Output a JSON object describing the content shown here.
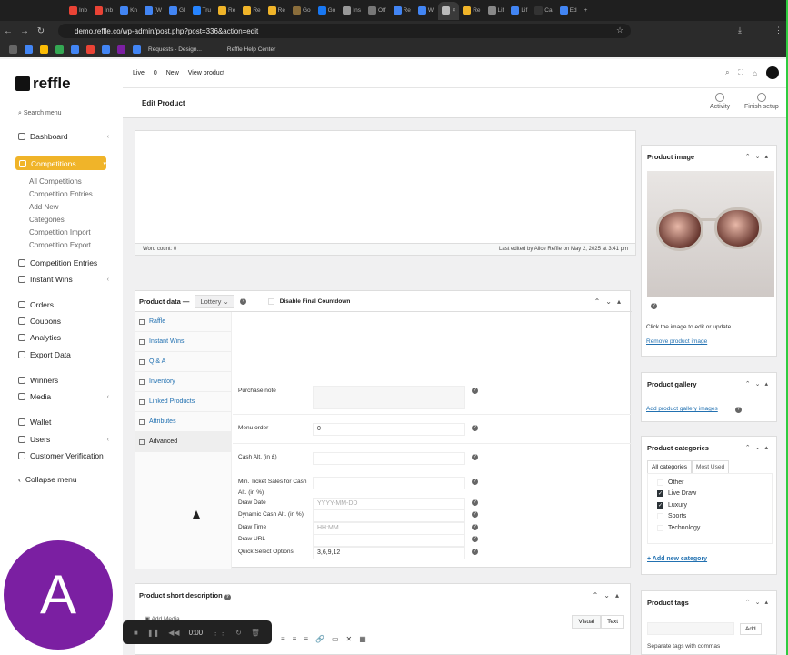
{
  "browser": {
    "tabs": [
      "Inb",
      "Inb",
      "Kn",
      "[W",
      "Gl",
      "Tru",
      "Re",
      "Re",
      "Re",
      "Go",
      "Go",
      "Ins",
      "Off",
      "Re",
      "Wl",
      "",
      "Re",
      "Lif",
      "Lif",
      "Ca",
      "Ed"
    ],
    "url": "demo.reffle.co/wp-admin/post.php?post=336&action=edit",
    "bookmarks": [
      "Requests - Design...",
      "Reffle Help Center"
    ]
  },
  "sidebar": {
    "logo": "reffle",
    "search": "Search menu",
    "items": {
      "dashboard": "Dashboard",
      "competitions": "Competitions",
      "competition_entries": "Competition Entries",
      "instant_wins": "Instant Wins",
      "orders": "Orders",
      "coupons": "Coupons",
      "analytics": "Analytics",
      "export_data": "Export Data",
      "winners": "Winners",
      "media": "Media",
      "wallet": "Wallet",
      "users": "Users",
      "customer_verification": "Customer Verification",
      "collapse": "Collapse menu"
    },
    "sub_items": [
      "All Competitions",
      "Competition Entries",
      "Add New",
      "Categories",
      "Competition Import",
      "Competition Export"
    ]
  },
  "topbar": {
    "live": "Live",
    "count": "0",
    "new": "New",
    "view": "View product"
  },
  "header": {
    "title": "Edit Product",
    "activity": "Activity",
    "finish_setup": "Finish setup"
  },
  "editor": {
    "word_count": "Word count: 0",
    "last_edited": "Last edited by Alice Reffle on May 2, 2025 at 3:41 pm"
  },
  "product_data": {
    "title": "Product data —",
    "type": "Lottery",
    "disable_countdown": "Disable Final Countdown",
    "tabs": [
      "Raffle",
      "Instant Wins",
      "Q & A",
      "Inventory",
      "Linked Products",
      "Attributes",
      "Advanced"
    ],
    "fields": {
      "purchase_note": "Purchase note",
      "menu_order": "Menu order",
      "menu_order_value": "0",
      "cash_alt": "Cash Alt. (in £)",
      "min_ticket": "Min. Ticket Sales for Cash Alt. (in %)",
      "dynamic_cash": "Dynamic Cash Alt. (in %)",
      "draw_url": "Draw URL",
      "draw_date": "Draw Date",
      "draw_date_ph": "YYYY-MM-DD",
      "draw_time": "Draw Time",
      "draw_time_ph": "HH:MM",
      "quick_select": "Quick Select Options",
      "quick_select_value": "3,6,9,12"
    }
  },
  "short_desc": {
    "title": "Product short description",
    "add_media": "Add Media",
    "visual": "Visual",
    "text": "Text"
  },
  "right_panels": {
    "image": {
      "title": "Product image",
      "hint": "Click the image to edit or update",
      "remove": "Remove product image"
    },
    "gallery": {
      "title": "Product gallery",
      "add": "Add product gallery images"
    },
    "categories": {
      "title": "Product categories",
      "tab_all": "All categories",
      "tab_used": "Most Used",
      "items": [
        "Other",
        "Live Draw",
        "Luxury",
        "Sports",
        "Technology"
      ],
      "add": "+ Add new category"
    },
    "tags": {
      "title": "Product tags",
      "add": "Add",
      "hint": "Separate tags with commas"
    }
  },
  "avatar": {
    "letter": "A"
  },
  "recorder": {
    "time": "0:00"
  }
}
